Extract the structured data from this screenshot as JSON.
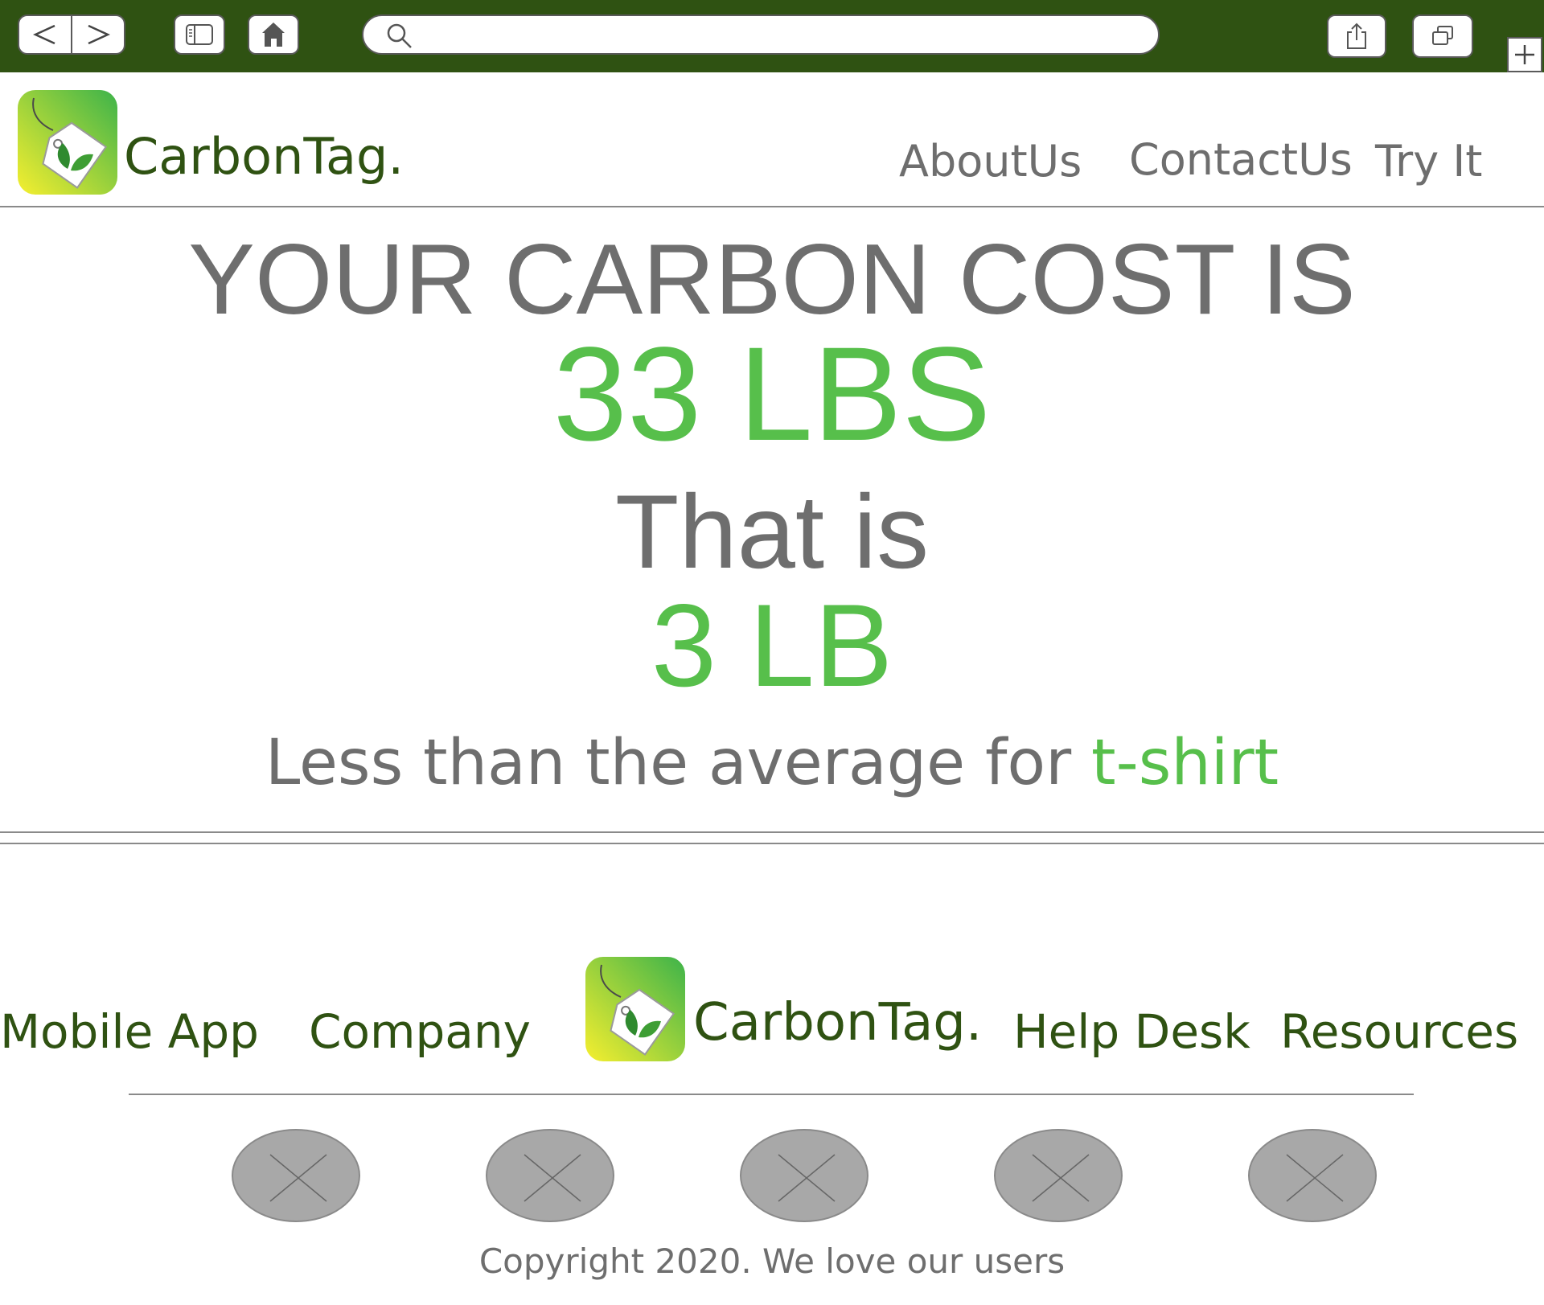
{
  "browser": {
    "url_value": "",
    "icons": [
      "back-icon",
      "forward-icon",
      "sidebar-icon",
      "home-icon",
      "search-icon",
      "share-icon",
      "tabs-icon",
      "plus-icon"
    ]
  },
  "header": {
    "brand": "CarbonTag.",
    "nav": [
      "AboutUs",
      "ContactUs",
      "Try It"
    ]
  },
  "result": {
    "title": "YOUR CARBON COST IS",
    "value": "33 LBS",
    "that_is": "That is",
    "equivalent": "3 LB",
    "comparison_prefix": "Less than the average for ",
    "comparison_item": "t-shirt"
  },
  "footer": {
    "links_left": [
      "Mobile App",
      "Company"
    ],
    "brand": "CarbonTag.",
    "links_right": [
      "Help Desk",
      "Resources"
    ],
    "social_count": 5,
    "copyright": "Copyright 2020. We love our users"
  },
  "colors": {
    "chrome_bar": "#2f5212",
    "brand_green": "#2f5212",
    "accent_green": "#57bf4b",
    "text_gray": "#6e6e6e",
    "placeholder_gray": "#a8a8a8"
  }
}
